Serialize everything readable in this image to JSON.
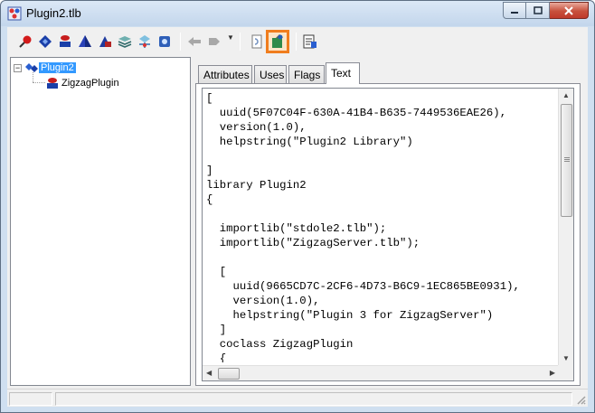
{
  "window": {
    "title": "Plugin2.tlb",
    "icon": "typelib-viewer-icon",
    "caption_buttons": [
      "minimize",
      "maximize",
      "close"
    ]
  },
  "toolbar": {
    "buttons": [
      {
        "name": "pin-icon",
        "color": "#d31b1b"
      },
      {
        "name": "diamond-icon",
        "color": "#1a3fa8"
      },
      {
        "name": "stack-red-icon",
        "color": "#c71e1e"
      },
      {
        "name": "pyramid-icon",
        "color": "#2a42b8"
      },
      {
        "name": "triangle-module-icon",
        "color": "#b32424"
      },
      {
        "name": "layers-icon",
        "color": "#3a8a8a"
      },
      {
        "name": "cube-nodes-icon",
        "color": "#2f6fb0"
      },
      {
        "name": "gear-cube-icon",
        "color": "#2f5fb8"
      },
      {
        "name": "back-arrow-icon",
        "color": "#a8a8a8",
        "disabled": true
      },
      {
        "name": "forward-arrow-icon",
        "color": "#a8a8a8",
        "disabled": true
      },
      {
        "name": "refresh-document-icon",
        "color": "#6f8fbf"
      },
      {
        "name": "export-idl-icon",
        "color": "#2f8a4a",
        "active": true
      },
      {
        "name": "properties-icon",
        "color": "#3a3a3a"
      }
    ],
    "highlight_color": "#f07d1e"
  },
  "tree": {
    "root": {
      "label": "Plugin2",
      "selected": true,
      "expanded": true
    },
    "children": [
      {
        "label": "ZigzagPlugin"
      }
    ]
  },
  "tabs": [
    {
      "label": "Attributes",
      "active": false
    },
    {
      "label": "Uses",
      "active": false
    },
    {
      "label": "Flags",
      "active": false
    },
    {
      "label": "Text",
      "active": true
    }
  ],
  "code_lines": [
    "[",
    "  uuid(5F07C04F-630A-41B4-B635-7449536EAE26),",
    "  version(1.0),",
    "  helpstring(\"Plugin2 Library\")",
    "",
    "]",
    "library Plugin2",
    "{",
    "",
    "  importlib(\"stdole2.tlb\");",
    "  importlib(\"ZigzagServer.tlb\");",
    "",
    "  [",
    "    uuid(9665CD7C-2CF6-4D73-B6C9-1EC865BE0931),",
    "    version(1.0),",
    "    helpstring(\"Plugin 3 for ZigzagServer\")",
    "  ]",
    "  coclass ZigzagPlugin",
    "  {"
  ],
  "status": {
    "panes": [
      "",
      ""
    ]
  }
}
